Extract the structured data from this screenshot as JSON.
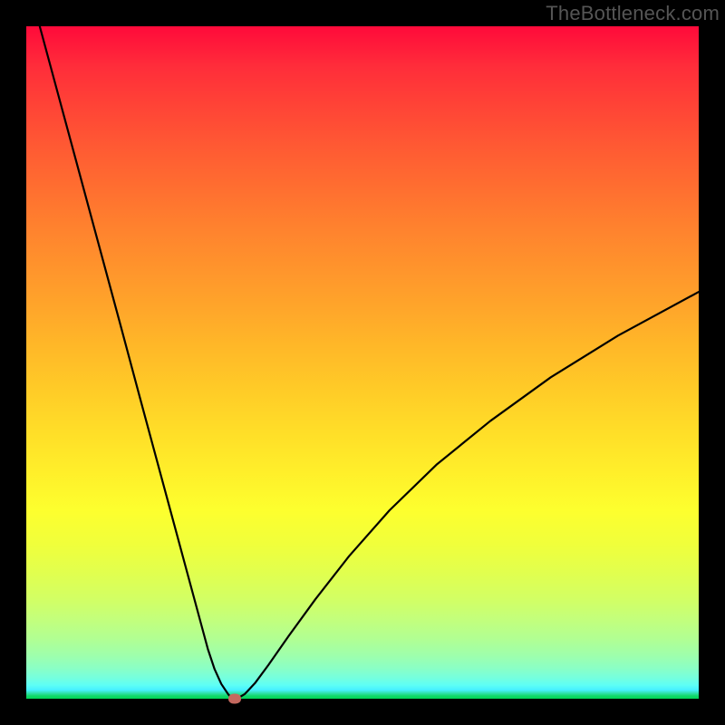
{
  "watermark": "TheBottleneck.com",
  "colors": {
    "frame": "#000000",
    "curve": "#000000",
    "marker": "#c4695f",
    "gradient_top": "#ff0a3a",
    "gradient_bottom": "#00d658"
  },
  "chart_data": {
    "type": "line",
    "title": "",
    "xlabel": "",
    "ylabel": "",
    "xlim": [
      0,
      100
    ],
    "ylim": [
      0,
      100
    ],
    "series": [
      {
        "name": "bottleneck-curve",
        "x": [
          2,
          5,
          8,
          11,
          14,
          17,
          20,
          22,
          24,
          26,
          27,
          28,
          29,
          30,
          30.5,
          31,
          31.5,
          32.5,
          34,
          36,
          39,
          43,
          48,
          54,
          61,
          69,
          78,
          88,
          100
        ],
        "y": [
          100,
          88.9,
          77.8,
          66.7,
          55.6,
          44.4,
          33.3,
          25.9,
          18.5,
          11.1,
          7.4,
          4.4,
          2.2,
          0.7,
          0.1,
          0.0,
          0.1,
          0.7,
          2.3,
          5.0,
          9.3,
          14.8,
          21.2,
          28.0,
          34.8,
          41.3,
          47.8,
          54.0,
          60.5
        ]
      }
    ],
    "marker": {
      "x": 31,
      "y": 0
    },
    "annotations": []
  }
}
